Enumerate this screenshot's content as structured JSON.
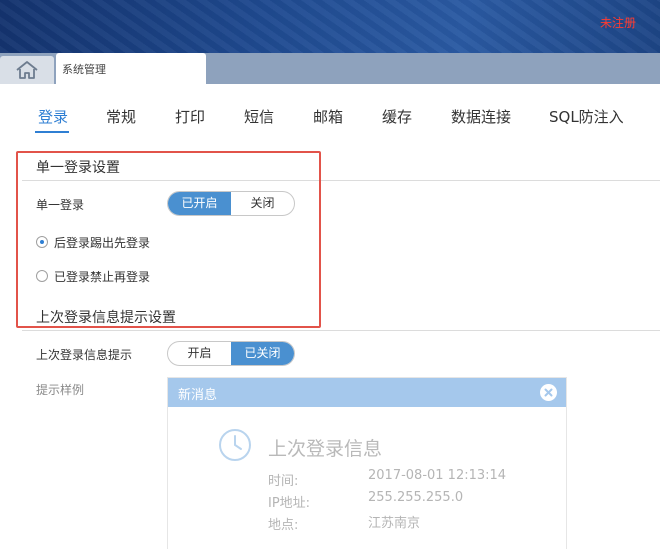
{
  "header": {
    "register_link": "未注册"
  },
  "tabbar": {
    "home_icon": "home-icon",
    "page_tab_label": "系统管理"
  },
  "settings_tabs": [
    {
      "label": "登录",
      "active": true
    },
    {
      "label": "常规"
    },
    {
      "label": "打印"
    },
    {
      "label": "短信"
    },
    {
      "label": "邮箱"
    },
    {
      "label": "缓存"
    },
    {
      "label": "数据连接"
    },
    {
      "label": "SQL防注入"
    }
  ],
  "single_login": {
    "section_title": "单一登录设置",
    "row_label": "单一登录",
    "toggle": {
      "on_label": "已开启",
      "off_label": "关闭",
      "state": "on"
    },
    "options": [
      {
        "label": "后登录踢出先登录",
        "checked": true
      },
      {
        "label": "已登录禁止再登录",
        "checked": false
      }
    ]
  },
  "last_login": {
    "section_title": "上次登录信息提示设置",
    "row_label": "上次登录信息提示",
    "toggle": {
      "on_label": "开启",
      "off_label": "已关闭",
      "state": "off"
    },
    "example_label": "提示样例"
  },
  "preview": {
    "header_title": "新消息",
    "close_icon": "close-icon",
    "clock_icon": "clock-icon",
    "title": "上次登录信息",
    "rows": [
      {
        "key": "时间:",
        "value": "2017-08-01 12:13:14"
      },
      {
        "key": "IP地址:",
        "value": "255.255.255.0"
      },
      {
        "key": "地点:",
        "value": "江苏南京"
      }
    ]
  },
  "colors": {
    "accent": "#2f7fd3",
    "toggle_on": "#4a90d0",
    "highlight": "#e2534a",
    "register": "#ff3b30"
  }
}
